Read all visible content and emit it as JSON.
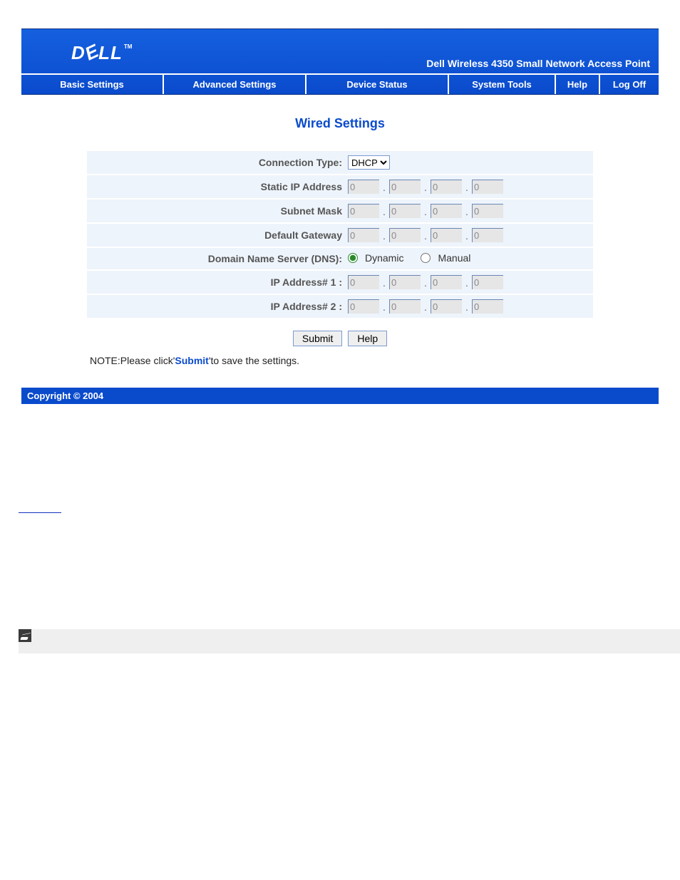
{
  "header": {
    "logo_text": "DELL",
    "trademark": "TM",
    "tagline": "Dell Wireless 4350 Small Network Access Point"
  },
  "nav": {
    "basic": "Basic Settings",
    "advanced": "Advanced Settings",
    "device_status": "Device Status",
    "system_tools": "System Tools",
    "help": "Help",
    "logoff": "Log Off"
  },
  "page": {
    "title": "Wired Settings"
  },
  "form": {
    "connection_type_label": "Connection Type:",
    "connection_type_value": "DHCP",
    "connection_type_options": [
      "DHCP"
    ],
    "static_ip_label": "Static IP Address",
    "subnet_mask_label": "Subnet Mask",
    "default_gateway_label": "Default Gateway",
    "dns_label": "Domain Name Server (DNS):",
    "dns_dynamic_label": "Dynamic",
    "dns_manual_label": "Manual",
    "dns_selected": "dynamic",
    "ip1_label": "IP Address# 1 :",
    "ip2_label": "IP Address# 2 :",
    "static_ip": [
      "0",
      "0",
      "0",
      "0"
    ],
    "subnet_mask": [
      "0",
      "0",
      "0",
      "0"
    ],
    "default_gateway": [
      "0",
      "0",
      "0",
      "0"
    ],
    "ip1": [
      "0",
      "0",
      "0",
      "0"
    ],
    "ip2": [
      "0",
      "0",
      "0",
      "0"
    ]
  },
  "buttons": {
    "submit": "Submit",
    "help": "Help"
  },
  "note": {
    "prefix": "NOTE:Please click",
    "quote_open": "'",
    "highlight": "Submit",
    "quote_close": "'",
    "suffix": "to save the settings."
  },
  "footer": {
    "copyright": "Copyright © 2004"
  }
}
